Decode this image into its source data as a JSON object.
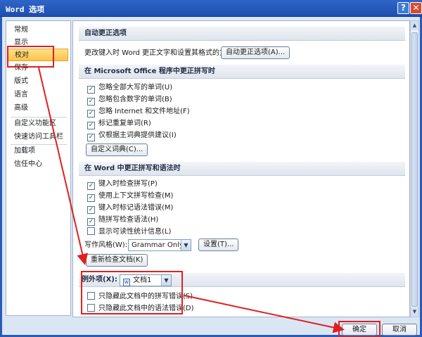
{
  "window": {
    "title": "Word 选项",
    "help_glyph": "?",
    "close_glyph": "✕"
  },
  "nav": {
    "items": [
      {
        "label": "常规"
      },
      {
        "label": "显示"
      },
      {
        "label": "校对"
      },
      {
        "label": "保存"
      },
      {
        "label": "版式"
      },
      {
        "label": "语言"
      },
      {
        "label": "高级"
      },
      {
        "label": "自定义功能区"
      },
      {
        "label": "快速访问工具栏"
      },
      {
        "label": "加载项"
      },
      {
        "label": "信任中心"
      }
    ],
    "selected_index": 2
  },
  "autocorrect": {
    "header": "自动更正选项",
    "description": "更改键入时 Word 更正文字和设置其格式的方式:",
    "button": "自动更正选项(A)..."
  },
  "office_spelling": {
    "header": "在 Microsoft Office 程序中更正拼写时",
    "options": [
      {
        "label": "忽略全部大写的单词(U)",
        "checked": true
      },
      {
        "label": "忽略包含数字的单词(B)",
        "checked": true
      },
      {
        "label": "忽略 Internet 和文件地址(F)",
        "checked": true
      },
      {
        "label": "标记重复单词(R)",
        "checked": true
      },
      {
        "label": "仅根据主词典提供建议(I)",
        "checked": true
      }
    ],
    "custom_dict_button": "自定义词典(C)..."
  },
  "word_spelling": {
    "header": "在 Word 中更正拼写和语法时",
    "options": [
      {
        "label": "键入时检查拼写(P)",
        "checked": true
      },
      {
        "label": "使用上下文拼写检查(M)",
        "checked": true
      },
      {
        "label": "键入时标记语法错误(M)",
        "checked": true
      },
      {
        "label": "随拼写检查语法(H)",
        "checked": true
      },
      {
        "label": "显示可读性统计信息(L)",
        "checked": false
      }
    ],
    "writing_style_label": "写作风格(W):",
    "writing_style_value": "Grammar Only",
    "settings_button": "设置(T)...",
    "recheck_button": "重新检查文档(K)"
  },
  "exceptions": {
    "label": "例外项(X):",
    "document": "文档1",
    "options": [
      {
        "label": "只隐藏此文档中的拼写错误(S)",
        "checked": false
      },
      {
        "label": "只隐藏此文档中的语法错误(D)",
        "checked": false
      }
    ]
  },
  "footer": {
    "ok": "确定",
    "cancel": "取消"
  },
  "colors": {
    "annotation": "#e02020",
    "titlebar": "#1e4fae",
    "selected_nav": "#ffc24a"
  },
  "icons": {
    "help": "help-icon",
    "close": "close-icon",
    "check": "checkmark-icon",
    "dropdown": "chevron-down-icon",
    "document": "document-icon"
  }
}
